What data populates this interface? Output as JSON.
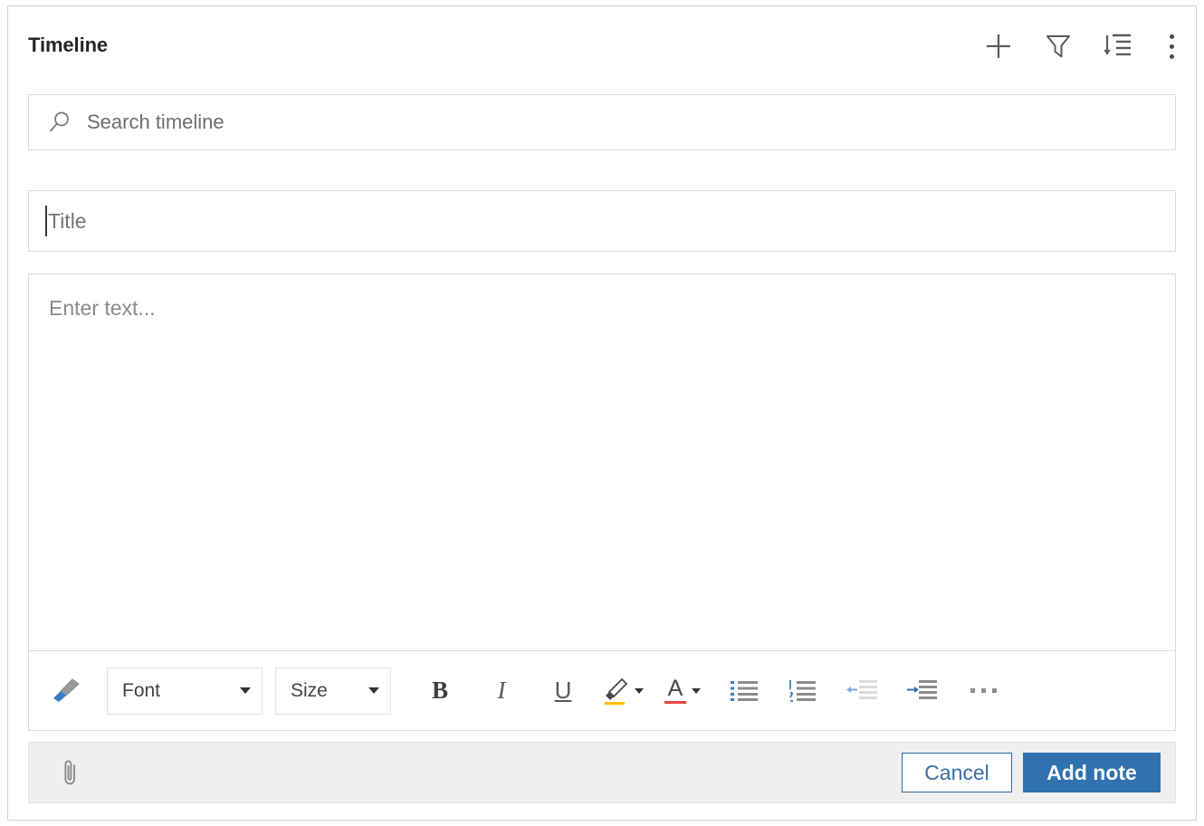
{
  "panel": {
    "title": "Timeline"
  },
  "header_actions": [
    {
      "name": "add-button",
      "icon": "plus-icon",
      "label": "Add"
    },
    {
      "name": "filter-button",
      "icon": "funnel-icon",
      "label": "Filter"
    },
    {
      "name": "sort-button",
      "icon": "sort-descending-icon",
      "label": "Sort"
    },
    {
      "name": "more-options-button",
      "icon": "more-vertical-icon",
      "label": "More options"
    }
  ],
  "search": {
    "placeholder": "Search timeline",
    "value": "",
    "icon": "search-icon"
  },
  "note_form": {
    "title_field": {
      "placeholder": "Title",
      "value": "",
      "focused": true
    },
    "body_field": {
      "placeholder": "Enter text...",
      "value": ""
    },
    "toolbar": {
      "format_painter": {
        "label": "Format painter",
        "icon": "paintbrush-icon"
      },
      "font": {
        "label": "Font",
        "value": "Font"
      },
      "size": {
        "label": "Size",
        "value": "Size"
      },
      "bold": {
        "label": "B"
      },
      "italic": {
        "label": "I"
      },
      "underline": {
        "label": "U"
      },
      "highlight": {
        "label": "Text highlight color",
        "icon": "highlighter-icon",
        "color": "#ffc000"
      },
      "font_color": {
        "label": "A",
        "icon": "font-color-icon",
        "color": "#e8443a"
      },
      "bulleted_list": {
        "label": "Bulleted list",
        "icon": "bulleted-list-icon"
      },
      "numbered_list": {
        "label": "Numbered list",
        "icon": "numbered-list-icon"
      },
      "decrease_indent": {
        "label": "Decrease indent",
        "icon": "decrease-indent-icon"
      },
      "increase_indent": {
        "label": "Increase indent",
        "icon": "increase-indent-icon"
      },
      "more": {
        "label": "More formatting options",
        "icon": "more-horizontal-icon"
      }
    },
    "footer": {
      "attach": {
        "label": "Attach file",
        "icon": "paperclip-icon"
      },
      "cancel_label": "Cancel",
      "submit_label": "Add note"
    }
  },
  "colors": {
    "accent": "#3071b0",
    "accent_border": "#2b6cab",
    "icon_blue": "#3a7ebf",
    "text": "#262626",
    "placeholder": "#767676",
    "border": "#dcdcdc",
    "footer_bg": "#efefef"
  }
}
